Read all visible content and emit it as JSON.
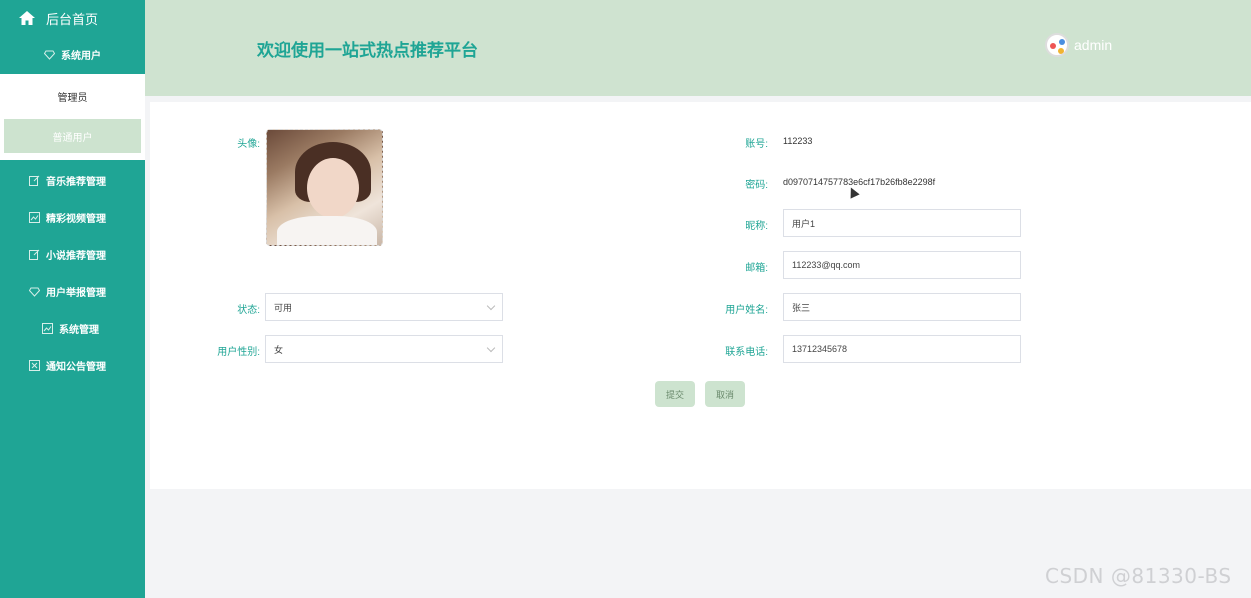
{
  "sidebar": {
    "home_label": "后台首页",
    "system_user_label": "系统用户",
    "sub_items": [
      "管理员",
      "普通用户"
    ],
    "items": [
      "音乐推荐管理",
      "精彩视频管理",
      "小说推荐管理",
      "用户举报管理",
      "系统管理",
      "通知公告管理"
    ]
  },
  "header": {
    "title": "欢迎使用一站式热点推荐平台",
    "username": "admin"
  },
  "form": {
    "avatar_label": "头像:",
    "account_label": "账号:",
    "account_value": "112233",
    "password_label": "密码:",
    "password_value": "d0970714757783e6cf17b26fb8e2298f",
    "nickname_label": "昵称:",
    "nickname_value": "用户1",
    "email_label": "邮箱:",
    "email_value": "112233@qq.com",
    "status_label": "状态:",
    "status_value": "可用",
    "realname_label": "用户姓名:",
    "realname_value": "张三",
    "gender_label": "用户性别:",
    "gender_value": "女",
    "phone_label": "联系电话:",
    "phone_value": "13712345678",
    "submit_label": "提交",
    "cancel_label": "取消"
  },
  "watermark": "CSDN @81330-BS",
  "colors": {
    "accent": "#1fa595",
    "header_bg": "#cfe3d0",
    "button_bg": "#cde3cf"
  }
}
